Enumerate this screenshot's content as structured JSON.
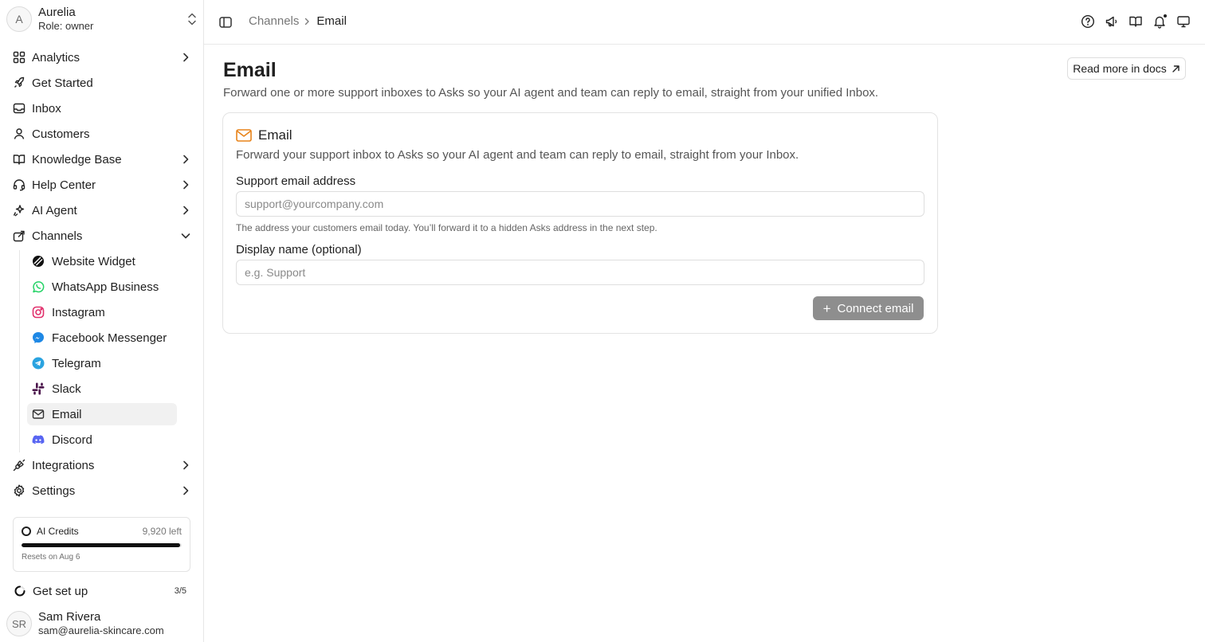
{
  "workspace": {
    "avatar_initial": "A",
    "name": "Aurelia",
    "role": "Role: owner"
  },
  "sidebar": {
    "items": [
      {
        "label": "Analytics",
        "icon": "grid-icon",
        "chevron": "right"
      },
      {
        "label": "Get Started",
        "icon": "rocket-icon"
      },
      {
        "label": "Inbox",
        "icon": "inbox-icon"
      },
      {
        "label": "Customers",
        "icon": "user-icon"
      },
      {
        "label": "Knowledge Base",
        "icon": "book-icon",
        "chevron": "right"
      },
      {
        "label": "Help Center",
        "icon": "headset-icon",
        "chevron": "right"
      },
      {
        "label": "AI Agent",
        "icon": "sparkle-icon",
        "chevron": "right"
      },
      {
        "label": "Channels",
        "icon": "share-icon",
        "chevron": "down"
      },
      {
        "label": "Integrations",
        "icon": "plug-icon",
        "chevron": "right"
      },
      {
        "label": "Settings",
        "icon": "gear-icon",
        "chevron": "right"
      }
    ],
    "channels": [
      {
        "label": "Website Widget",
        "icon": "widget-icon"
      },
      {
        "label": "WhatsApp Business",
        "icon": "whatsapp-icon"
      },
      {
        "label": "Instagram",
        "icon": "instagram-icon"
      },
      {
        "label": "Facebook Messenger",
        "icon": "messenger-icon"
      },
      {
        "label": "Telegram",
        "icon": "telegram-icon"
      },
      {
        "label": "Slack",
        "icon": "slack-icon"
      },
      {
        "label": "Email",
        "icon": "mail-icon",
        "active": true
      },
      {
        "label": "Discord",
        "icon": "discord-icon"
      }
    ],
    "credits": {
      "label": "AI Credits",
      "remaining": "9,920 left",
      "fraction_remaining": 0.992,
      "reset": "Resets on Aug 6"
    },
    "setup": {
      "label": "Get set up",
      "progress": "3/5"
    },
    "user": {
      "initials": "SR",
      "name": "Sam Rivera",
      "email": "sam@aurelia-skincare.com"
    }
  },
  "topbar": {
    "breadcrumb_parent": "Channels",
    "breadcrumb_current": "Email",
    "icons": [
      "help-icon",
      "megaphone-icon",
      "docs-icon",
      "bell-icon",
      "monitor-icon"
    ]
  },
  "main": {
    "title": "Email",
    "subtitle": "Forward one or more support inboxes to Asks so your AI agent and team can reply to email, straight from your unified Inbox.",
    "docs_button": "Read more in docs",
    "card": {
      "title": "Email",
      "description": "Forward your support inbox to Asks so your AI agent and team can reply to email, straight from your Inbox.",
      "email_label": "Support email address",
      "email_value": "",
      "email_placeholder": "support@yourcompany.com",
      "email_help": "The address your customers email today. You’ll forward it to a hidden Asks address in the next step.",
      "name_label": "Display name (optional)",
      "name_value": "",
      "name_placeholder": "e.g. Support",
      "connect_button": "Connect email"
    }
  },
  "colors": {
    "accent_orange": "#e8831a",
    "active_bg": "#f1f1f1",
    "disabled_button": "#8e8e8e",
    "whatsapp": "#25d366",
    "instagram": "#e1306c",
    "messenger": "#1e88e5",
    "telegram": "#2aa3e0",
    "slack": "#4a154b",
    "discord": "#5865f2"
  }
}
